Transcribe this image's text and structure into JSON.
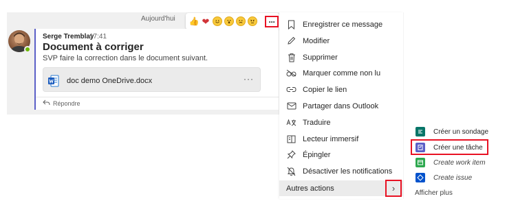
{
  "chat": {
    "date_label": "Aujourd'hui",
    "sender": "Serge Tremblay",
    "time": "17:41",
    "subject": "Document à corriger",
    "body": "SVP faire la correction dans le document suivant.",
    "attachment": {
      "name": "doc demo OneDrive.docx",
      "more": "···"
    },
    "reply_label": "Répondre"
  },
  "reactions": {
    "items": [
      "like-icon",
      "heart-icon",
      "laugh-icon",
      "surprised-icon",
      "sad-icon",
      "angry-icon"
    ],
    "more": "···"
  },
  "menu": {
    "items": [
      {
        "label": "Enregistrer ce message",
        "icon": "bookmark-icon"
      },
      {
        "label": "Modifier",
        "icon": "pencil-icon"
      },
      {
        "label": "Supprimer",
        "icon": "trash-icon"
      },
      {
        "label": "Marquer comme non lu",
        "icon": "glasses-icon"
      },
      {
        "label": "Copier le lien",
        "icon": "link-icon"
      },
      {
        "label": "Partager dans Outlook",
        "icon": "mail-icon"
      },
      {
        "label": "Traduire",
        "icon": "translate-icon"
      },
      {
        "label": "Lecteur immersif",
        "icon": "immersive-reader-icon"
      },
      {
        "label": "Épingler",
        "icon": "pin-icon"
      },
      {
        "label": "Désactiver les notifications",
        "icon": "bell-off-icon"
      }
    ],
    "more_actions": "Autres actions",
    "chevron": "›"
  },
  "submenu": {
    "items": [
      {
        "label": "Créer un sondage",
        "icon": "forms-icon",
        "color": "#077568",
        "italic": false
      },
      {
        "label": "Créer une tâche",
        "icon": "tasks-icon",
        "color": "#5b5fc7",
        "italic": false
      },
      {
        "label": "Create work item",
        "icon": "boards-icon",
        "color": "#2ea84f",
        "italic": true
      },
      {
        "label": "Create issue",
        "icon": "jira-icon",
        "color": "#0052cc",
        "italic": true
      }
    ],
    "show_more": "Afficher plus"
  },
  "colors": {
    "accent": "#5b5fc7",
    "highlight_border": "#e81123",
    "presence": "#6bb700"
  }
}
